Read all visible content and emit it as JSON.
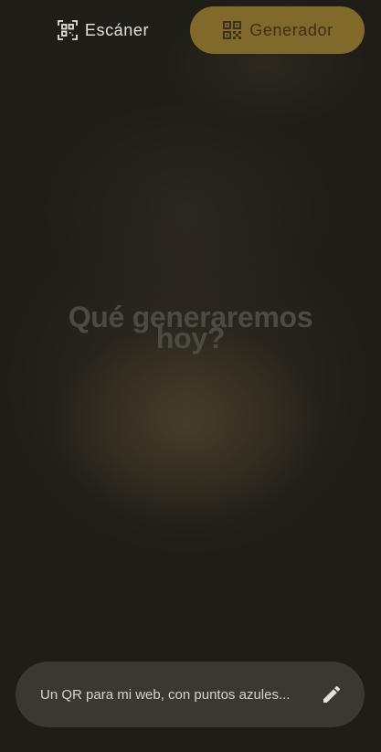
{
  "tabs": [
    {
      "label": "Escáner",
      "icon": "qr-scan-icon",
      "selected": false
    },
    {
      "label": "Generador",
      "icon": "qr-code-icon",
      "selected": true
    }
  ],
  "headline": {
    "line1": "Qué generaremos",
    "line2": "hoy?"
  },
  "prompt": {
    "placeholder": "Un QR para mi web, con puntos azules...",
    "value": "",
    "action_icon": "pencil-icon"
  },
  "colors": {
    "background": "#1f1d18",
    "accent": "#80692a",
    "accent_text": "#3b3118",
    "input_background": "#3a3833"
  }
}
